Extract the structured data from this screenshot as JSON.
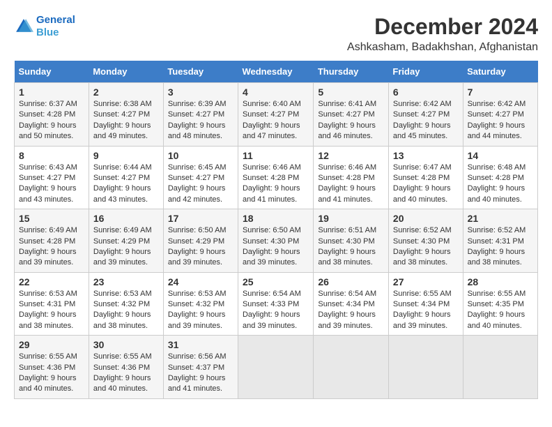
{
  "header": {
    "logo_line1": "General",
    "logo_line2": "Blue",
    "month": "December 2024",
    "location": "Ashkasham, Badakhshan, Afghanistan"
  },
  "days_of_week": [
    "Sunday",
    "Monday",
    "Tuesday",
    "Wednesday",
    "Thursday",
    "Friday",
    "Saturday"
  ],
  "weeks": [
    [
      {
        "day": "1",
        "sunrise": "Sunrise: 6:37 AM",
        "sunset": "Sunset: 4:28 PM",
        "daylight": "Daylight: 9 hours and 50 minutes."
      },
      {
        "day": "2",
        "sunrise": "Sunrise: 6:38 AM",
        "sunset": "Sunset: 4:27 PM",
        "daylight": "Daylight: 9 hours and 49 minutes."
      },
      {
        "day": "3",
        "sunrise": "Sunrise: 6:39 AM",
        "sunset": "Sunset: 4:27 PM",
        "daylight": "Daylight: 9 hours and 48 minutes."
      },
      {
        "day": "4",
        "sunrise": "Sunrise: 6:40 AM",
        "sunset": "Sunset: 4:27 PM",
        "daylight": "Daylight: 9 hours and 47 minutes."
      },
      {
        "day": "5",
        "sunrise": "Sunrise: 6:41 AM",
        "sunset": "Sunset: 4:27 PM",
        "daylight": "Daylight: 9 hours and 46 minutes."
      },
      {
        "day": "6",
        "sunrise": "Sunrise: 6:42 AM",
        "sunset": "Sunset: 4:27 PM",
        "daylight": "Daylight: 9 hours and 45 minutes."
      },
      {
        "day": "7",
        "sunrise": "Sunrise: 6:42 AM",
        "sunset": "Sunset: 4:27 PM",
        "daylight": "Daylight: 9 hours and 44 minutes."
      }
    ],
    [
      {
        "day": "8",
        "sunrise": "Sunrise: 6:43 AM",
        "sunset": "Sunset: 4:27 PM",
        "daylight": "Daylight: 9 hours and 43 minutes."
      },
      {
        "day": "9",
        "sunrise": "Sunrise: 6:44 AM",
        "sunset": "Sunset: 4:27 PM",
        "daylight": "Daylight: 9 hours and 43 minutes."
      },
      {
        "day": "10",
        "sunrise": "Sunrise: 6:45 AM",
        "sunset": "Sunset: 4:27 PM",
        "daylight": "Daylight: 9 hours and 42 minutes."
      },
      {
        "day": "11",
        "sunrise": "Sunrise: 6:46 AM",
        "sunset": "Sunset: 4:28 PM",
        "daylight": "Daylight: 9 hours and 41 minutes."
      },
      {
        "day": "12",
        "sunrise": "Sunrise: 6:46 AM",
        "sunset": "Sunset: 4:28 PM",
        "daylight": "Daylight: 9 hours and 41 minutes."
      },
      {
        "day": "13",
        "sunrise": "Sunrise: 6:47 AM",
        "sunset": "Sunset: 4:28 PM",
        "daylight": "Daylight: 9 hours and 40 minutes."
      },
      {
        "day": "14",
        "sunrise": "Sunrise: 6:48 AM",
        "sunset": "Sunset: 4:28 PM",
        "daylight": "Daylight: 9 hours and 40 minutes."
      }
    ],
    [
      {
        "day": "15",
        "sunrise": "Sunrise: 6:49 AM",
        "sunset": "Sunset: 4:28 PM",
        "daylight": "Daylight: 9 hours and 39 minutes."
      },
      {
        "day": "16",
        "sunrise": "Sunrise: 6:49 AM",
        "sunset": "Sunset: 4:29 PM",
        "daylight": "Daylight: 9 hours and 39 minutes."
      },
      {
        "day": "17",
        "sunrise": "Sunrise: 6:50 AM",
        "sunset": "Sunset: 4:29 PM",
        "daylight": "Daylight: 9 hours and 39 minutes."
      },
      {
        "day": "18",
        "sunrise": "Sunrise: 6:50 AM",
        "sunset": "Sunset: 4:30 PM",
        "daylight": "Daylight: 9 hours and 39 minutes."
      },
      {
        "day": "19",
        "sunrise": "Sunrise: 6:51 AM",
        "sunset": "Sunset: 4:30 PM",
        "daylight": "Daylight: 9 hours and 38 minutes."
      },
      {
        "day": "20",
        "sunrise": "Sunrise: 6:52 AM",
        "sunset": "Sunset: 4:30 PM",
        "daylight": "Daylight: 9 hours and 38 minutes."
      },
      {
        "day": "21",
        "sunrise": "Sunrise: 6:52 AM",
        "sunset": "Sunset: 4:31 PM",
        "daylight": "Daylight: 9 hours and 38 minutes."
      }
    ],
    [
      {
        "day": "22",
        "sunrise": "Sunrise: 6:53 AM",
        "sunset": "Sunset: 4:31 PM",
        "daylight": "Daylight: 9 hours and 38 minutes."
      },
      {
        "day": "23",
        "sunrise": "Sunrise: 6:53 AM",
        "sunset": "Sunset: 4:32 PM",
        "daylight": "Daylight: 9 hours and 38 minutes."
      },
      {
        "day": "24",
        "sunrise": "Sunrise: 6:53 AM",
        "sunset": "Sunset: 4:32 PM",
        "daylight": "Daylight: 9 hours and 39 minutes."
      },
      {
        "day": "25",
        "sunrise": "Sunrise: 6:54 AM",
        "sunset": "Sunset: 4:33 PM",
        "daylight": "Daylight: 9 hours and 39 minutes."
      },
      {
        "day": "26",
        "sunrise": "Sunrise: 6:54 AM",
        "sunset": "Sunset: 4:34 PM",
        "daylight": "Daylight: 9 hours and 39 minutes."
      },
      {
        "day": "27",
        "sunrise": "Sunrise: 6:55 AM",
        "sunset": "Sunset: 4:34 PM",
        "daylight": "Daylight: 9 hours and 39 minutes."
      },
      {
        "day": "28",
        "sunrise": "Sunrise: 6:55 AM",
        "sunset": "Sunset: 4:35 PM",
        "daylight": "Daylight: 9 hours and 40 minutes."
      }
    ],
    [
      {
        "day": "29",
        "sunrise": "Sunrise: 6:55 AM",
        "sunset": "Sunset: 4:36 PM",
        "daylight": "Daylight: 9 hours and 40 minutes."
      },
      {
        "day": "30",
        "sunrise": "Sunrise: 6:55 AM",
        "sunset": "Sunset: 4:36 PM",
        "daylight": "Daylight: 9 hours and 40 minutes."
      },
      {
        "day": "31",
        "sunrise": "Sunrise: 6:56 AM",
        "sunset": "Sunset: 4:37 PM",
        "daylight": "Daylight: 9 hours and 41 minutes."
      },
      null,
      null,
      null,
      null
    ]
  ]
}
